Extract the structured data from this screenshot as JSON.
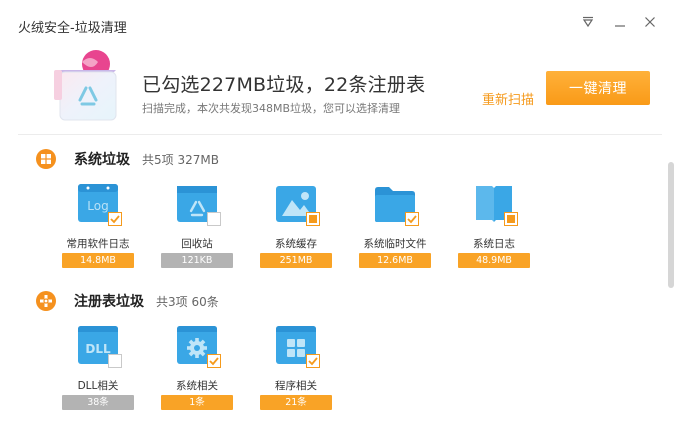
{
  "window": {
    "title": "火绒安全-垃圾清理"
  },
  "summary": {
    "headline": "已勾选227MB垃圾，22条注册表",
    "subline": "扫描完成，本次共发现348MB垃圾，您可以选择清理",
    "rescan_label": "重新扫描",
    "clean_label": "一键清理"
  },
  "colors": {
    "accent": "#f59a1c",
    "tile_blue": "#3aa7e6",
    "badge_off": "#b3b3b3"
  },
  "sections": [
    {
      "title": "系统垃圾",
      "stats": "共5项 327MB",
      "icon": "windows-icon",
      "items": [
        {
          "label": "常用软件日志",
          "size": "14.8MB",
          "state": "checked",
          "icon": "log-file-icon"
        },
        {
          "label": "回收站",
          "size": "121KB",
          "state": "unchecked",
          "icon": "recycle-bin-icon"
        },
        {
          "label": "系统缓存",
          "size": "251MB",
          "state": "partial",
          "icon": "image-cache-icon"
        },
        {
          "label": "系统临时文件",
          "size": "12.6MB",
          "state": "checked",
          "icon": "folder-icon"
        },
        {
          "label": "系统日志",
          "size": "48.9MB",
          "state": "partial",
          "icon": "book-icon"
        }
      ]
    },
    {
      "title": "注册表垃圾",
      "stats": "共3项 60条",
      "icon": "registry-icon",
      "items": [
        {
          "label": "DLL相关",
          "size": "38条",
          "state": "unchecked",
          "icon": "dll-icon"
        },
        {
          "label": "系统相关",
          "size": "1条",
          "state": "checked",
          "icon": "system-gear-icon"
        },
        {
          "label": "程序相关",
          "size": "21条",
          "state": "checked",
          "icon": "program-icon"
        }
      ]
    }
  ]
}
